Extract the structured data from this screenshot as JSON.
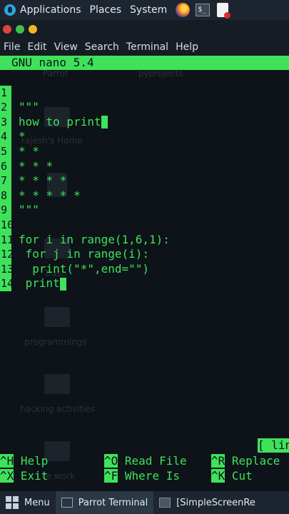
{
  "top_panel": {
    "menus": [
      "Applications",
      "Places",
      "System"
    ],
    "icons": [
      "parrot-logo",
      "firefox-icon",
      "terminal-icon",
      "text-editor-icon"
    ]
  },
  "window": {
    "controls": {
      "close": "#e0443e",
      "minimize": "#f0b429",
      "maximize": "#3fc04a"
    },
    "menu": [
      "File",
      "Edit",
      "View",
      "Search",
      "Terminal",
      "Help"
    ]
  },
  "nano": {
    "title": "GNU nano 5.4",
    "lines": [
      {
        "n": "1",
        "text": "\"\"\""
      },
      {
        "n": "2",
        "text": "how to print"
      },
      {
        "n": "3",
        "text": "*"
      },
      {
        "n": "4",
        "text": "* *"
      },
      {
        "n": "5",
        "text": "* * *"
      },
      {
        "n": "6",
        "text": "* * * *"
      },
      {
        "n": "7",
        "text": "* * * * *"
      },
      {
        "n": "8",
        "text": "\"\"\""
      },
      {
        "n": "9",
        "text": ""
      },
      {
        "n": "10",
        "text": "for i in range(1,6,1):"
      },
      {
        "n": "11",
        "text": " for j in range(i):"
      },
      {
        "n": "12",
        "text": "  print(\"*\",end=\"\")"
      },
      {
        "n": "13",
        "text": " print"
      },
      {
        "n": "14",
        "text": ""
      }
    ],
    "status": "[ lin",
    "shortcuts": [
      {
        "key": "^H",
        "label": "Help"
      },
      {
        "key": "^X",
        "label": "Exit"
      },
      {
        "key": "^O",
        "label": "Read File"
      },
      {
        "key": "^F",
        "label": "Where Is"
      },
      {
        "key": "^R",
        "label": "Replace"
      },
      {
        "key": "^K",
        "label": "Cut"
      }
    ]
  },
  "background_desktop": [
    "Parrot",
    "pyprojects",
    "rajesh's Home",
    "Trash",
    "programmings",
    "hacking activities",
    "ce work"
  ],
  "taskbar": {
    "menu_label": "Menu",
    "tasks": [
      "Parrot Terminal",
      "[SimpleScreenRe"
    ]
  },
  "colors": {
    "accent": "#3fe25a",
    "panel": "#1c2530",
    "terminal_bg": "#0d1318"
  }
}
